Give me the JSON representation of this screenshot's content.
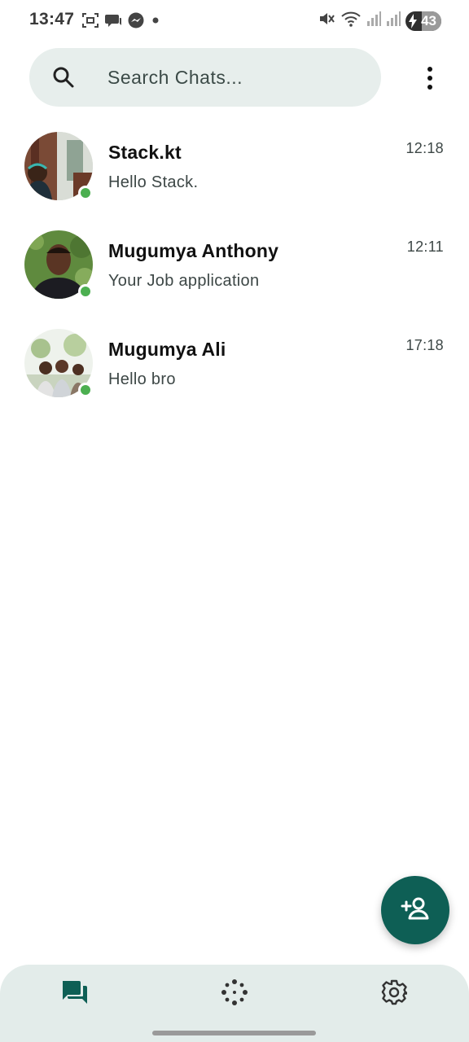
{
  "status_bar": {
    "time": "13:47",
    "left_icons": [
      "screenshot-icon",
      "chat-bubble-icon",
      "messenger-icon",
      "notification-dot-icon"
    ],
    "right_icons": [
      "mute-icon",
      "wifi-icon",
      "signal-icon",
      "signal-icon"
    ],
    "battery_level": "43",
    "battery_charging": true
  },
  "search": {
    "placeholder": "Search Chats...",
    "value": ""
  },
  "menu": {
    "icon": "more-vert-icon"
  },
  "chats": [
    {
      "name": "Stack.kt",
      "preview": "Hello Stack.",
      "time": "12:18",
      "online": true
    },
    {
      "name": "Mugumya Anthony",
      "preview": "Your Job application",
      "time": "12:11",
      "online": true
    },
    {
      "name": "Mugumya Ali",
      "preview": "Hello bro",
      "time": "17:18",
      "online": true
    }
  ],
  "fab": {
    "icon": "add-person-icon"
  },
  "bottom_nav": {
    "items": [
      {
        "icon": "chats-icon",
        "active": true
      },
      {
        "icon": "status-icon",
        "active": false
      },
      {
        "icon": "settings-icon",
        "active": false
      }
    ]
  },
  "colors": {
    "accent": "#0e5f55",
    "online": "#4caf50",
    "search_bg": "#e7eeec",
    "nav_bg": "#e3ecea"
  }
}
